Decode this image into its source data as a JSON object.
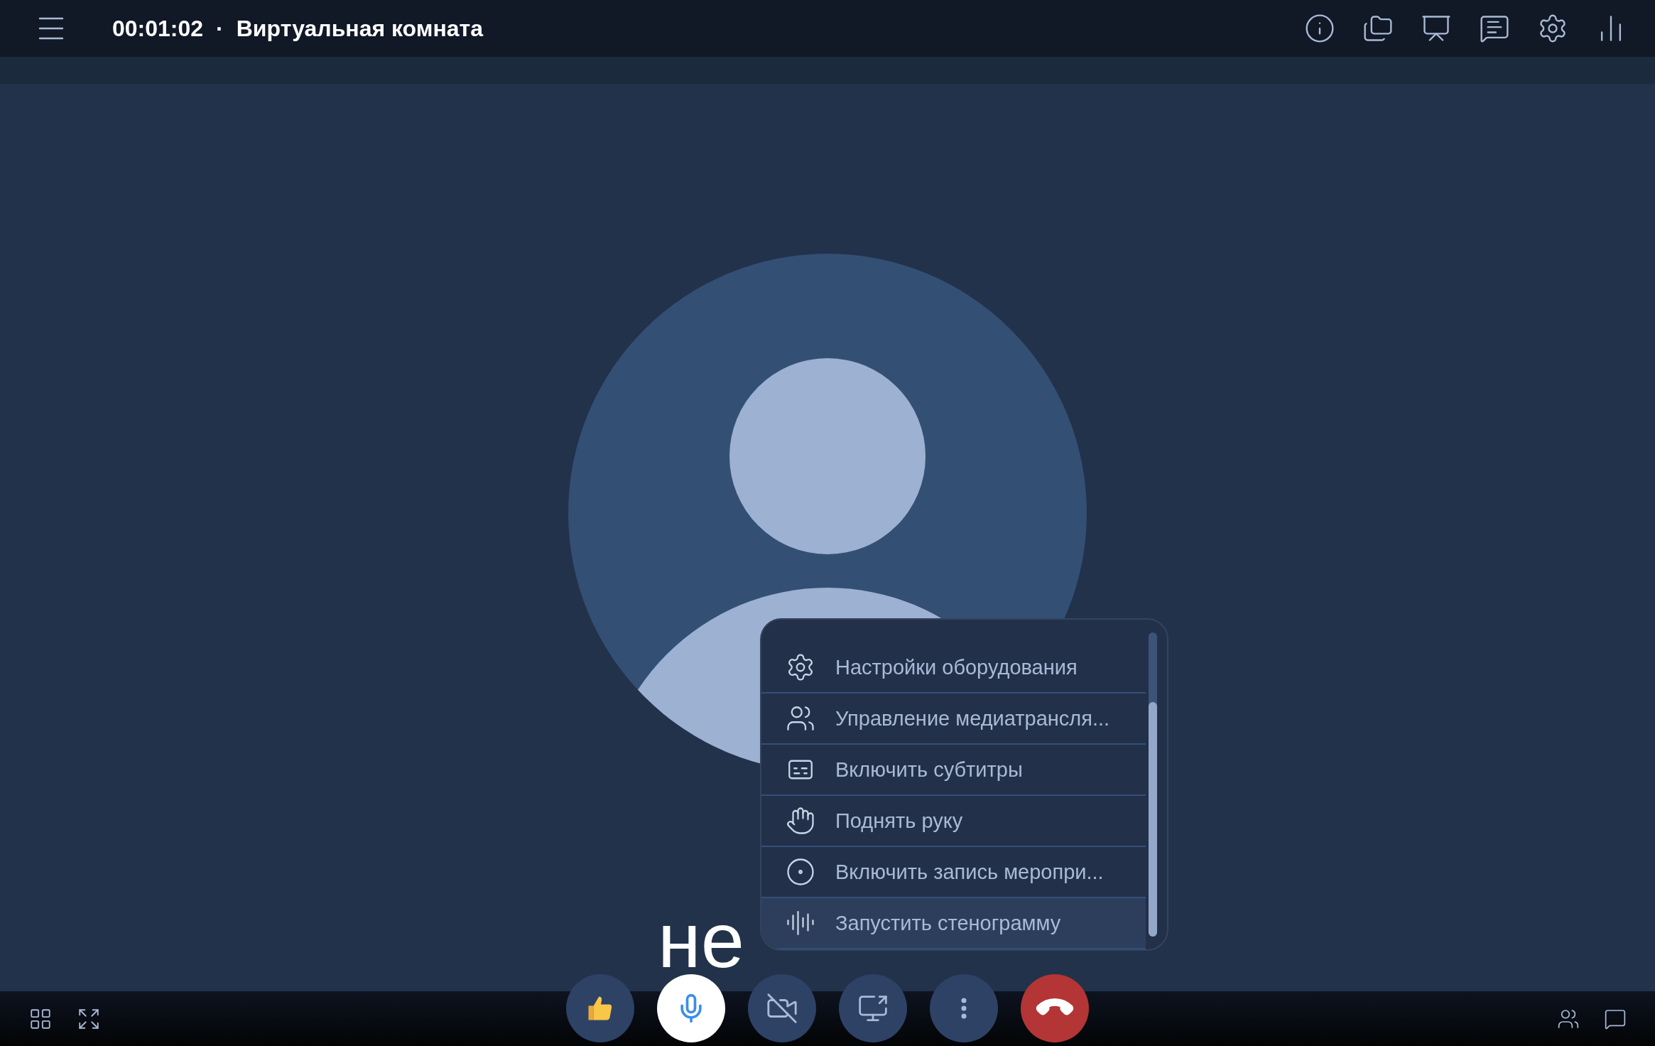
{
  "top_bar": {
    "time": "00:01:02",
    "separator": "·",
    "title": "Виртуальная комната"
  },
  "subtitle": "не",
  "menu": {
    "items": [
      {
        "label": "Настройки оборудования",
        "highlighted": false
      },
      {
        "label": "Управление медиатрансля...",
        "highlighted": false
      },
      {
        "label": "Включить субтитры",
        "highlighted": false
      },
      {
        "label": "Поднять руку",
        "highlighted": false
      },
      {
        "label": "Включить запись меропри...",
        "highlighted": false
      },
      {
        "label": "Запустить стенограмму",
        "highlighted": true
      }
    ]
  },
  "controls": [
    {
      "kind": "reaction"
    },
    {
      "kind": "mic",
      "on": true
    },
    {
      "kind": "camera",
      "on": false
    },
    {
      "kind": "share"
    },
    {
      "kind": "more"
    },
    {
      "kind": "hangup"
    }
  ]
}
